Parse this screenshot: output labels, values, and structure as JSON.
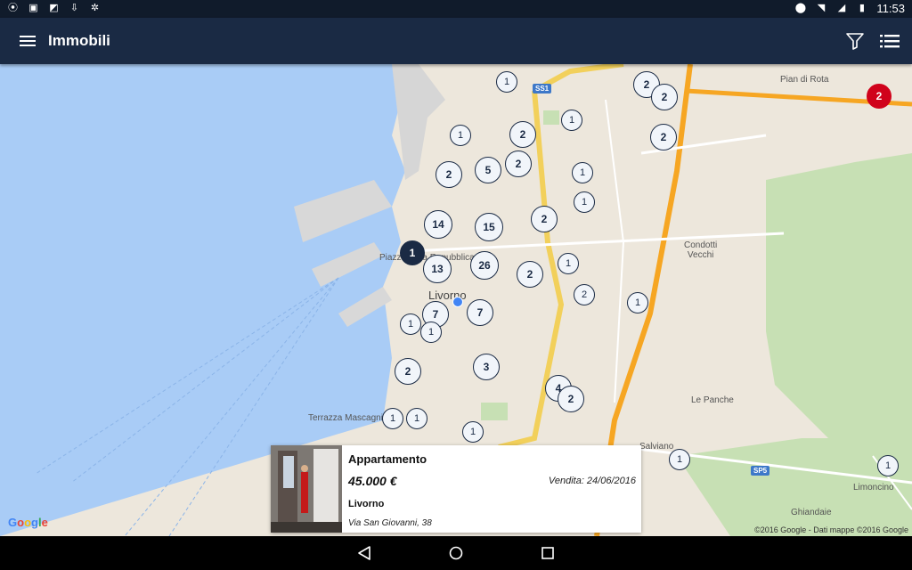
{
  "status_bar": {
    "time": "11:53"
  },
  "app_bar": {
    "title": "Immobili"
  },
  "map": {
    "labels": {
      "pian_di_rota": "Pian di Rota",
      "condotti_vecchi": "Condotti\nVecchi",
      "livorno": "Livorno",
      "piazza": "Piazza della Repubblica",
      "le_panche": "Le Panche",
      "salviano": "Salviano",
      "terrazza": "Terrazza Mascagni",
      "limoncino": "Limoncino",
      "ghiandaie": "Ghiandaie",
      "ss1": "SS1",
      "sp5": "SP5"
    },
    "clusters": [
      "1",
      "2",
      "2",
      "2",
      "1",
      "2",
      "2",
      "5",
      "2",
      "1",
      "1",
      "2",
      "14",
      "15",
      "2",
      "1",
      "13",
      "26",
      "2",
      "1",
      "1",
      "7",
      "7",
      "1",
      "1",
      "2",
      "3",
      "4",
      "2",
      "1",
      "1",
      "1",
      "1",
      "1"
    ],
    "selected_marker": "1",
    "red_marker": "2",
    "google": "Google",
    "copyright": "©2016 Google - Dati mappe ©2016 Google"
  },
  "listing_card": {
    "type": "Appartamento",
    "price": "45.000 €",
    "date": "Vendita: 24/06/2016",
    "city": "Livorno",
    "address": "Via San Giovanni, 38"
  },
  "colors": {
    "appbar": "#1a2a44",
    "red_marker": "#d0021b",
    "sea": "#a9ccf6"
  }
}
